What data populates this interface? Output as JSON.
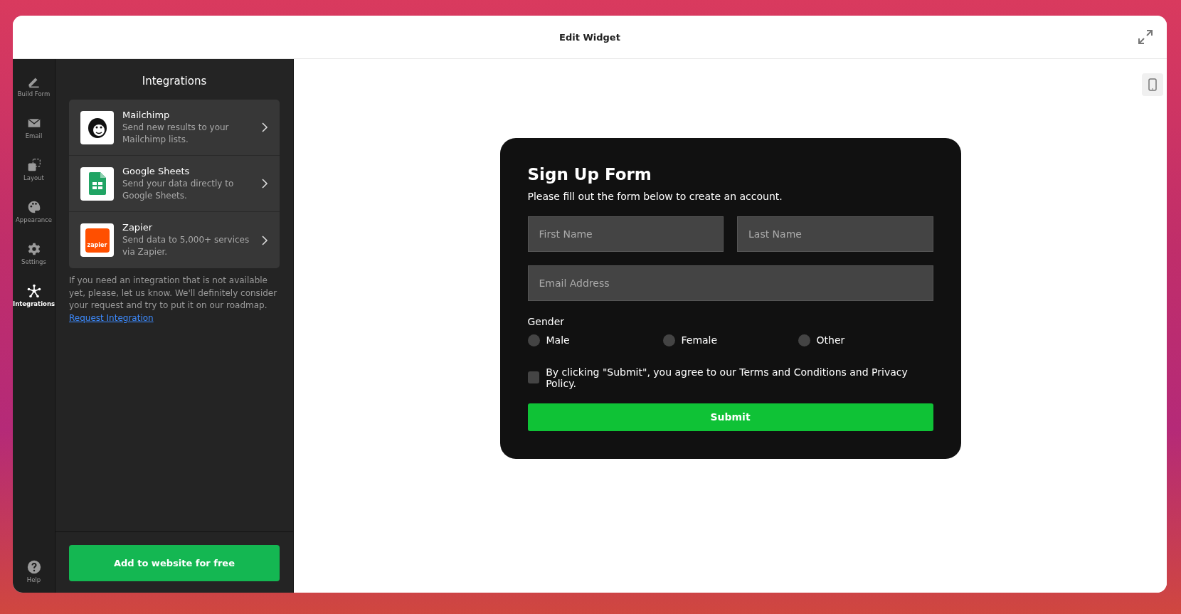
{
  "window": {
    "title": "Edit Widget"
  },
  "nav": [
    {
      "label": "Build Form",
      "kind": "pencil",
      "selected": false
    },
    {
      "label": "Email",
      "kind": "mail",
      "selected": false
    },
    {
      "label": "Layout",
      "kind": "layout",
      "selected": false
    },
    {
      "label": "Appearance",
      "kind": "palette",
      "selected": false
    },
    {
      "label": "Settings",
      "kind": "gear",
      "selected": false
    },
    {
      "label": "Integrations",
      "kind": "network",
      "selected": true
    }
  ],
  "help": {
    "label": "Help"
  },
  "panel": {
    "title": "Integrations",
    "integrations": [
      {
        "kind": "mailchimp",
        "name": "Mailchimp",
        "description": "Send new results to your Mailchimp lists."
      },
      {
        "kind": "sheets",
        "name": "Google Sheets",
        "description": "Send your data directly to Google Sheets."
      },
      {
        "kind": "zapier",
        "name": "Zapier",
        "description": "Send data to 5,000+ services via Zapier.",
        "logo_text": "zapier"
      }
    ],
    "note": "If you need an integration that is not available yet, please, let us know. We'll definitely consider your request and try to put it on our roadmap.",
    "note_link": "Request Integration",
    "cta": "Add to website for free"
  },
  "form": {
    "title": "Sign Up Form",
    "subtitle": "Please fill out the form below to create an account.",
    "fields": [
      {
        "placeholder": "First Name"
      },
      {
        "placeholder": "Last Name"
      },
      {
        "placeholder": "Email Address"
      }
    ],
    "gender_label": "Gender",
    "gender_options": [
      {
        "label": "Male",
        "selected": false
      },
      {
        "label": "Female",
        "selected": false
      },
      {
        "label": "Other",
        "selected": false
      }
    ],
    "agreement": {
      "label": "By clicking \"Submit\", you agree to our Terms and Conditions and Privacy Policy.",
      "checked": false
    },
    "submit": "Submit"
  }
}
